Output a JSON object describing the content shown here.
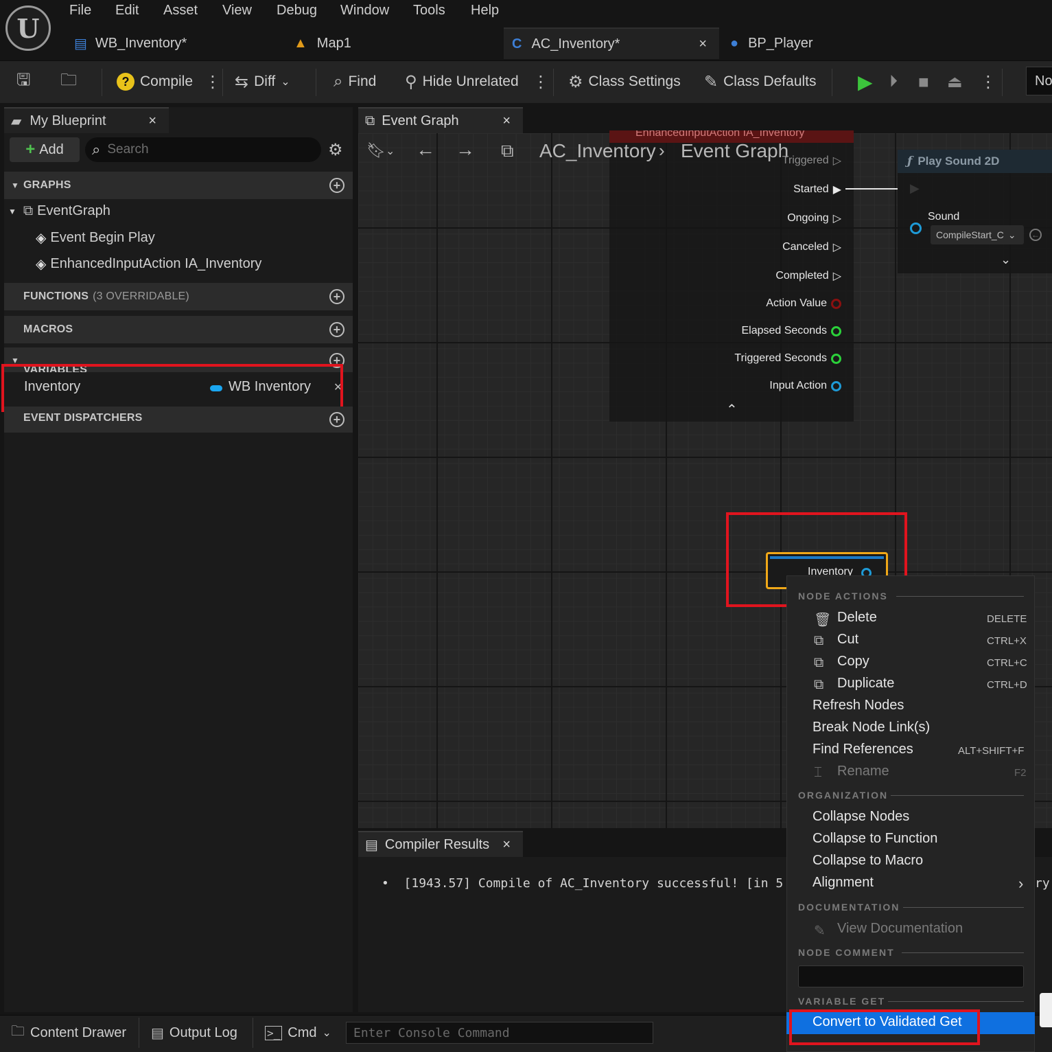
{
  "menu": [
    "File",
    "Edit",
    "Asset",
    "View",
    "Debug",
    "Window",
    "Tools",
    "Help"
  ],
  "doc_tabs": [
    {
      "label": "WB_Inventory*"
    },
    {
      "label": "Map1"
    },
    {
      "label": "AC_Inventory*",
      "close": "×"
    },
    {
      "label": "BP_Player"
    }
  ],
  "toolbar": {
    "compile": "Compile",
    "diff": "Diff",
    "find": "Find",
    "hide_unrelated": "Hide Unrelated",
    "class_settings": "Class Settings",
    "class_defaults": "Class Defaults",
    "right_cut": "No"
  },
  "my_blueprint": {
    "tab": "My Blueprint",
    "close": "×",
    "add": "Add",
    "search_placeholder": "Search",
    "graphs_header": "GRAPHS",
    "graph_items": [
      "EventGraph",
      "Event Begin Play",
      "EnhancedInputAction IA_Inventory"
    ],
    "functions_header": "FUNCTIONS",
    "functions_count": "(3 OVERRIDABLE)",
    "macros_header": "MACROS",
    "variables_header": "VARIABLES",
    "variable": {
      "name": "Inventory",
      "type": "WB Inventory"
    },
    "dispatchers_header": "EVENT DISPATCHERS"
  },
  "event_graph": {
    "tab": "Event Graph",
    "close": "×",
    "breadcrumb_root": "AC_Inventory",
    "breadcrumb_leaf": "Event Graph",
    "event_node_title": "EnhancedInputAction IA_Inventory",
    "pins": [
      {
        "label": "Triggered",
        "kind": "exec"
      },
      {
        "label": "Started",
        "kind": "exec"
      },
      {
        "label": "Ongoing",
        "kind": "exec"
      },
      {
        "label": "Canceled",
        "kind": "exec"
      },
      {
        "label": "Completed",
        "kind": "exec"
      },
      {
        "label": "Action Value",
        "kind": "data",
        "color": "#8a1010"
      },
      {
        "label": "Elapsed Seconds",
        "kind": "data",
        "color": "#2bd13a"
      },
      {
        "label": "Triggered Seconds",
        "kind": "data",
        "color": "#2bd13a"
      },
      {
        "label": "Input Action",
        "kind": "data",
        "color": "#1e9ad6"
      }
    ],
    "play_sound": {
      "title": "Play Sound 2D",
      "sound_label": "Sound",
      "sound_value": "CompileStart_C"
    },
    "inventory_node": {
      "label": "Inventory"
    }
  },
  "context_menu": {
    "node_actions": "NODE ACTIONS",
    "items": [
      {
        "label": "Delete",
        "shortcut": "DELETE"
      },
      {
        "label": "Cut",
        "shortcut": "CTRL+X"
      },
      {
        "label": "Copy",
        "shortcut": "CTRL+C"
      },
      {
        "label": "Duplicate",
        "shortcut": "CTRL+D"
      },
      {
        "label": "Refresh Nodes",
        "shortcut": ""
      },
      {
        "label": "Break Node Link(s)",
        "shortcut": ""
      },
      {
        "label": "Find References",
        "shortcut": "ALT+SHIFT+F"
      },
      {
        "label": "Rename",
        "shortcut": "F2"
      }
    ],
    "organization": "ORGANIZATION",
    "org_items": [
      "Collapse Nodes",
      "Collapse to Function",
      "Collapse to Macro",
      "Alignment"
    ],
    "documentation": "DOCUMENTATION",
    "view_documentation": "View Documentation",
    "node_comment": "NODE COMMENT",
    "variable_get": "VARIABLE GET",
    "convert": "Convert to Validated Get"
  },
  "compiler": {
    "tab": "Compiler Results",
    "close": "×",
    "log": "[1943.57] Compile of AC_Inventory successful! [in 5",
    "log_tail": "ry."
  },
  "statusbar": {
    "content_drawer": "Content Drawer",
    "output_log": "Output Log",
    "cmd": "Cmd",
    "console_placeholder": "Enter Console Command"
  },
  "colors": {
    "highlight_red": "#e0141e",
    "selection_blue": "#0f70e0",
    "node_orange": "#f0a818"
  }
}
